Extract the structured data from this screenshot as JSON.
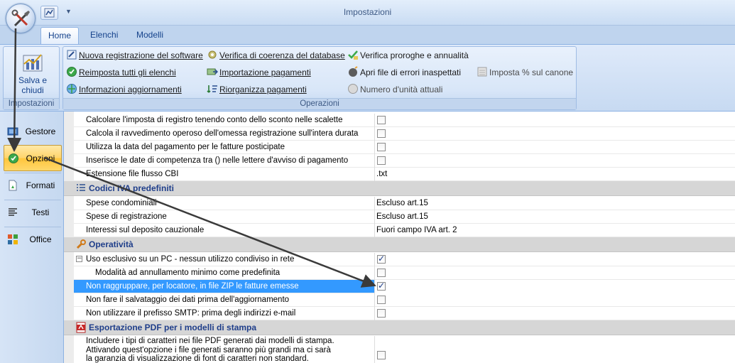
{
  "window": {
    "title": "Impostazioni"
  },
  "tabs": [
    {
      "label": "Home",
      "active": true
    },
    {
      "label": "Elenchi",
      "active": false
    },
    {
      "label": "Modelli",
      "active": false
    }
  ],
  "ribbon": {
    "impostazioni_group": {
      "label": "Impostazioni",
      "save_button": {
        "line1": "Salva e",
        "line2": "chiudi"
      }
    },
    "operazioni_group": {
      "label": "Operazioni",
      "col1": [
        {
          "label": "Nuova registrazione del software",
          "icon": "new-registration-icon"
        },
        {
          "label": "Reimposta tutti gli elenchi",
          "icon": "reset-lists-icon"
        },
        {
          "label": "Informazioni aggiornamenti",
          "icon": "update-info-icon"
        }
      ],
      "col2": [
        {
          "label": "Verifica di coerenza del database",
          "icon": "database-check-icon"
        },
        {
          "label": "Importazione pagamenti",
          "icon": "import-payments-icon"
        },
        {
          "label": "Riorganizza pagamenti",
          "icon": "reorganize-payments-icon"
        }
      ],
      "col3": [
        {
          "label": "Verifica proroghe e annualità",
          "icon": "check-extensions-icon"
        },
        {
          "label": "Apri file di errori inaspettati",
          "icon": "error-file-icon"
        },
        {
          "label": "Numero d'unità attuali",
          "icon": "unit-count-icon"
        }
      ],
      "col4": [
        {
          "label": "Imposta  % sul canone",
          "icon": "percent-rent-icon"
        }
      ]
    }
  },
  "leftnav": [
    {
      "label": "Gestore",
      "icon": "manager-icon",
      "selected": false
    },
    {
      "label": "Opzioni",
      "icon": "options-check-icon",
      "selected": true
    },
    {
      "label": "Formati",
      "icon": "formats-icon",
      "selected": false
    },
    {
      "label": "Testi",
      "icon": "texts-icon",
      "selected": false
    },
    {
      "label": "Office",
      "icon": "office-icon",
      "selected": false
    }
  ],
  "grid": {
    "rows_top": [
      {
        "label": "Calcolare l'imposta di registro tenendo conto dello sconto nelle scalette",
        "checked": false
      },
      {
        "label": "Calcola il ravvedimento operoso dell'omessa registrazione sull'intera durata",
        "checked": false
      },
      {
        "label": "Utilizza la data del pagamento per le fatture posticipate",
        "checked": false
      },
      {
        "label": "Inserisce le date di competenza tra () nelle lettere d'avviso di pagamento",
        "checked": false
      },
      {
        "label": "Estensione file flusso CBI",
        "value": ".txt"
      }
    ],
    "cat_iva": {
      "label": "Codici IVA predefiniti",
      "icon": "list-icon"
    },
    "rows_iva": [
      {
        "label": "Spese condominiali",
        "value": "Escluso art.15"
      },
      {
        "label": "Spese di registrazione",
        "value": "Escluso art.15"
      },
      {
        "label": "Interessi sul deposito cauzionale",
        "value": "Fuori campo IVA art. 2"
      }
    ],
    "cat_oper": {
      "label": "Operatività",
      "icon": "wrench-icon"
    },
    "rows_oper": [
      {
        "label": "Uso esclusivo su un PC - nessun utilizzo condiviso in rete",
        "checked": true,
        "expander": "−"
      },
      {
        "label": "Modalità ad annullamento minimo come predefinita",
        "checked": false
      },
      {
        "label": "Non raggruppare, per locatore, in file ZIP le fatture emesse",
        "checked": true,
        "selected": true
      },
      {
        "label": "Non fare il salvataggio dei dati prima dell'aggiornamento",
        "checked": false
      },
      {
        "label": "Non utilizzare il prefisso SMTP: prima degli indirizzi e-mail",
        "checked": false
      }
    ],
    "cat_pdf": {
      "label": "Esportazione PDF per i modelli di stampa",
      "icon": "pdf-icon"
    },
    "rows_pdf": [
      {
        "line1": "Includere i tipi di caratteri nei file PDF generati dai modelli di stampa.",
        "line2": "Attivando quest'opzione i file generati saranno più grandi ma ci sarà",
        "line3": "la garanzia di visualizzazione di font di caratteri non standard.",
        "checked": false
      }
    ]
  },
  "colors": {
    "accent": "#15428b",
    "selection": "#3399ff",
    "category_bg": "#d6d6d6",
    "nav_selected": "#ffd46a"
  }
}
